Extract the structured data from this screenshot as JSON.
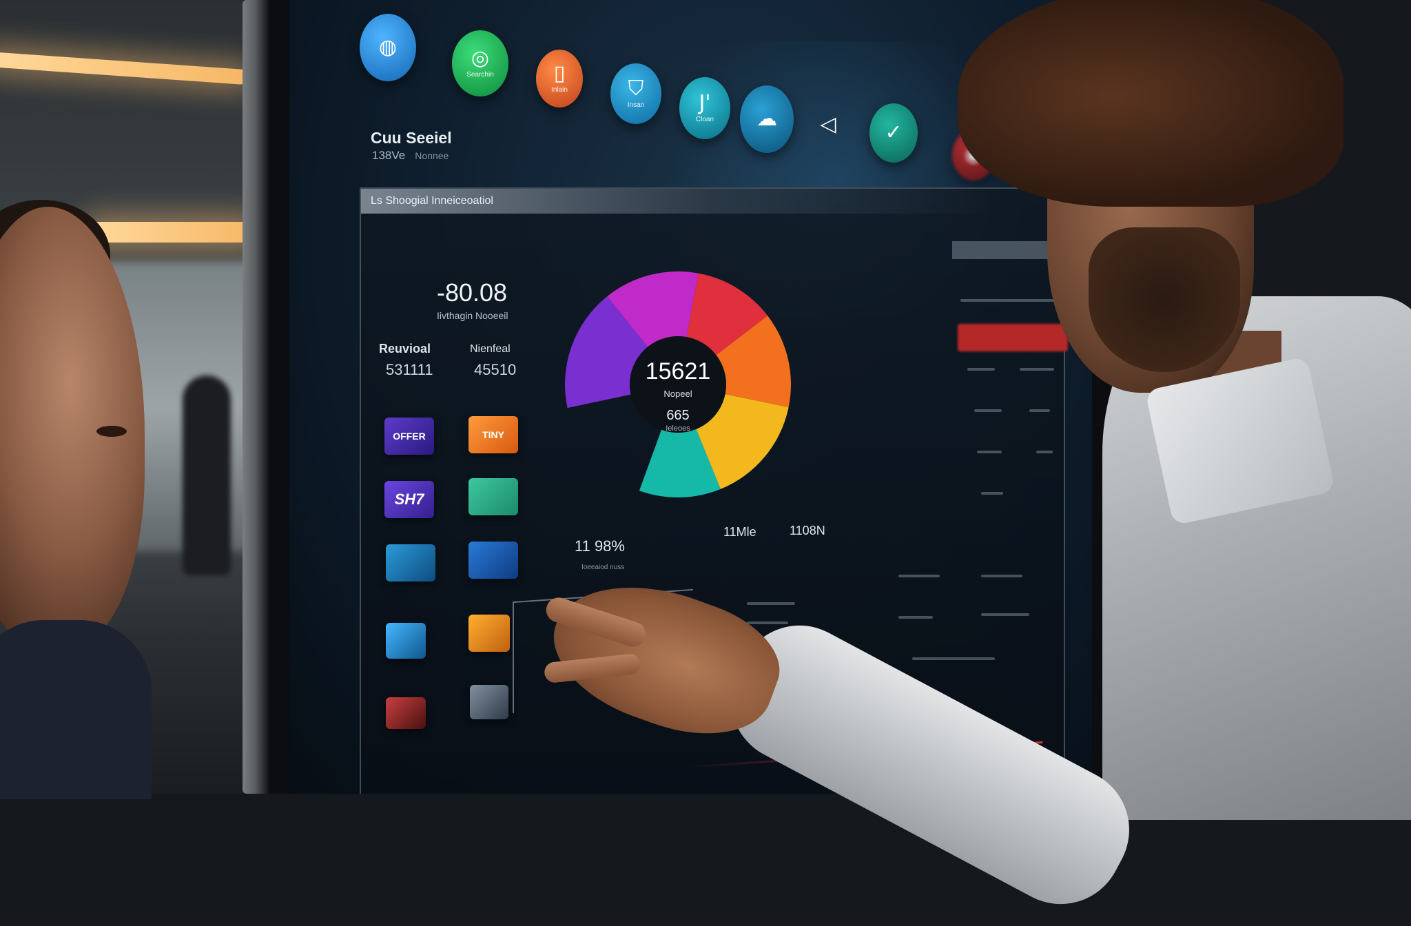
{
  "screen": {
    "app_icons": [
      {
        "name": "chat",
        "glyph": "◍",
        "caption": ""
      },
      {
        "name": "search",
        "glyph": "◎",
        "caption": "Searchin"
      },
      {
        "name": "mobile",
        "glyph": "▯",
        "caption": "Inlain"
      },
      {
        "name": "shield",
        "glyph": "⛉",
        "caption": "Insan"
      },
      {
        "name": "cursor",
        "glyph": "J'",
        "caption": "Cloan"
      },
      {
        "name": "cloud",
        "glyph": "☁",
        "caption": ""
      },
      {
        "name": "back",
        "glyph": "◁",
        "caption": ""
      },
      {
        "name": "check",
        "glyph": "✓",
        "caption": ""
      },
      {
        "name": "alert",
        "glyph": "◉",
        "caption": ""
      }
    ],
    "brand_title": "Cuu Seeiel",
    "brand_value": "138Ve",
    "brand_note": "Nonnee",
    "panel_header": "Ls Shoogial Inneiceoatiol",
    "main_stat": "-80.08",
    "main_stat_label": "Iivthagin Nooeeil",
    "kpis": [
      {
        "label": "Reuvioal",
        "value": "531111"
      },
      {
        "label": "Nienfeal",
        "value": "45510"
      }
    ],
    "tiles": [
      "OFFER",
      "TINY",
      "SH7",
      "",
      "",
      "",
      "",
      "",
      "",
      ""
    ],
    "chart_center": {
      "value": "15621",
      "label": "Nopeel",
      "sub_value": "665",
      "sub_label": "Ieleoes"
    },
    "below_chart": {
      "left_value": "11 98%",
      "left_label": "Ioeeaiod nuss",
      "right_value": "11Mle",
      "far_right_value": "1108N"
    }
  },
  "chart_data": {
    "type": "pie",
    "categories": [
      "violet",
      "magenta",
      "red",
      "orange",
      "yellow",
      "teal"
    ],
    "values": [
      18,
      14,
      12,
      14,
      16,
      12
    ],
    "colors": [
      "#7a2fd0",
      "#c02ac8",
      "#e0303e",
      "#f2701e",
      "#f2b81e",
      "#16b8a8"
    ],
    "title": "",
    "center_value": "15621"
  }
}
